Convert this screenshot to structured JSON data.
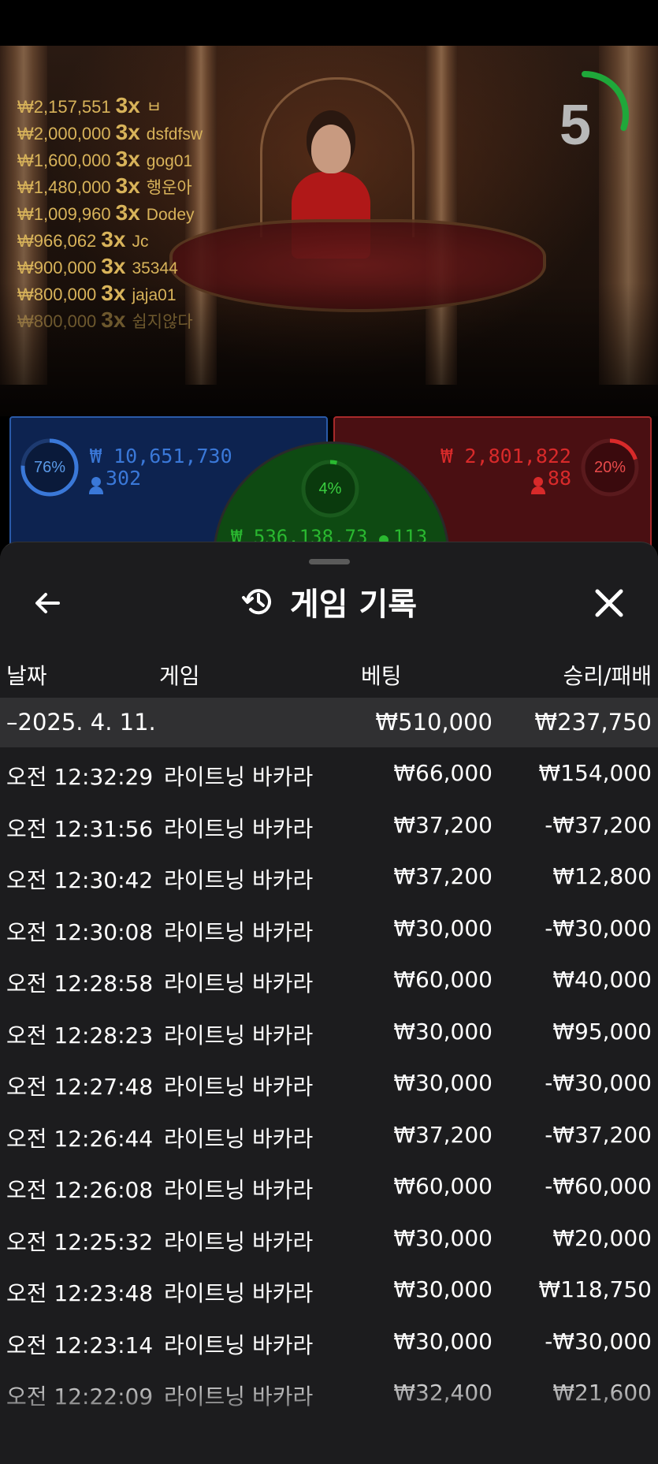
{
  "game": {
    "winners": [
      {
        "amount": "₩2,157,551",
        "multiplier": "3x",
        "name": "ㅂ"
      },
      {
        "amount": "₩2,000,000",
        "multiplier": "3x",
        "name": "dsfdfsw"
      },
      {
        "amount": "₩1,600,000",
        "multiplier": "3x",
        "name": "gog01"
      },
      {
        "amount": "₩1,480,000",
        "multiplier": "3x",
        "name": "행운아"
      },
      {
        "amount": "₩1,009,960",
        "multiplier": "3x",
        "name": "Dodey"
      },
      {
        "amount": "₩966,062",
        "multiplier": "3x",
        "name": "Jc"
      },
      {
        "amount": "₩900,000",
        "multiplier": "3x",
        "name": "35344"
      },
      {
        "amount": "₩800,000",
        "multiplier": "3x",
        "name": "jaja01"
      },
      {
        "amount": "₩800,000",
        "multiplier": "3x",
        "name": "쉽지않다"
      }
    ],
    "timer": {
      "value": "5",
      "progress": 0.3
    },
    "player": {
      "percent": "76%",
      "percent_value": 0.76,
      "amount": "₩ 10,651,730",
      "count": "302"
    },
    "banker": {
      "percent": "20%",
      "percent_value": 0.2,
      "amount": "₩ 2,801,822",
      "count": "88"
    },
    "tie": {
      "percent": "4%",
      "percent_value": 0.04,
      "amount": "₩ 536,138.73",
      "count": "113"
    }
  },
  "history": {
    "title": "게임 기록",
    "back_icon": "arrow-left-icon",
    "history_icon": "history-clock-icon",
    "close_icon": "close-icon",
    "columns": {
      "date": "날짜",
      "game": "게임",
      "bet": "베팅",
      "result": "승리/패배"
    },
    "summary": {
      "date": "–2025. 4. 11.",
      "bet": "₩510,000",
      "result": "₩237,750"
    },
    "rows": [
      {
        "time": "오전 12:32:29",
        "game": "라이트닝 바카라",
        "bet": "₩66,000",
        "result": "₩154,000"
      },
      {
        "time": "오전 12:31:56",
        "game": "라이트닝 바카라",
        "bet": "₩37,200",
        "result": "-₩37,200"
      },
      {
        "time": "오전 12:30:42",
        "game": "라이트닝 바카라",
        "bet": "₩37,200",
        "result": "₩12,800"
      },
      {
        "time": "오전 12:30:08",
        "game": "라이트닝 바카라",
        "bet": "₩30,000",
        "result": "-₩30,000"
      },
      {
        "time": "오전 12:28:58",
        "game": "라이트닝 바카라",
        "bet": "₩60,000",
        "result": "₩40,000"
      },
      {
        "time": "오전 12:28:23",
        "game": "라이트닝 바카라",
        "bet": "₩30,000",
        "result": "₩95,000"
      },
      {
        "time": "오전 12:27:48",
        "game": "라이트닝 바카라",
        "bet": "₩30,000",
        "result": "-₩30,000"
      },
      {
        "time": "오전 12:26:44",
        "game": "라이트닝 바카라",
        "bet": "₩37,200",
        "result": "-₩37,200"
      },
      {
        "time": "오전 12:26:08",
        "game": "라이트닝 바카라",
        "bet": "₩60,000",
        "result": "-₩60,000"
      },
      {
        "time": "오전 12:25:32",
        "game": "라이트닝 바카라",
        "bet": "₩30,000",
        "result": "₩20,000"
      },
      {
        "time": "오전 12:23:48",
        "game": "라이트닝 바카라",
        "bet": "₩30,000",
        "result": "₩118,750"
      },
      {
        "time": "오전 12:23:14",
        "game": "라이트닝 바카라",
        "bet": "₩30,000",
        "result": "-₩30,000"
      },
      {
        "time": "오전 12:22:09",
        "game": "라이트닝 바카라",
        "bet": "₩32,400",
        "result": "₩21,600"
      }
    ]
  },
  "colors": {
    "player": "#3a78d8",
    "banker": "#d82a2a",
    "tie": "#2ab830",
    "gold": "#d8b35a"
  }
}
